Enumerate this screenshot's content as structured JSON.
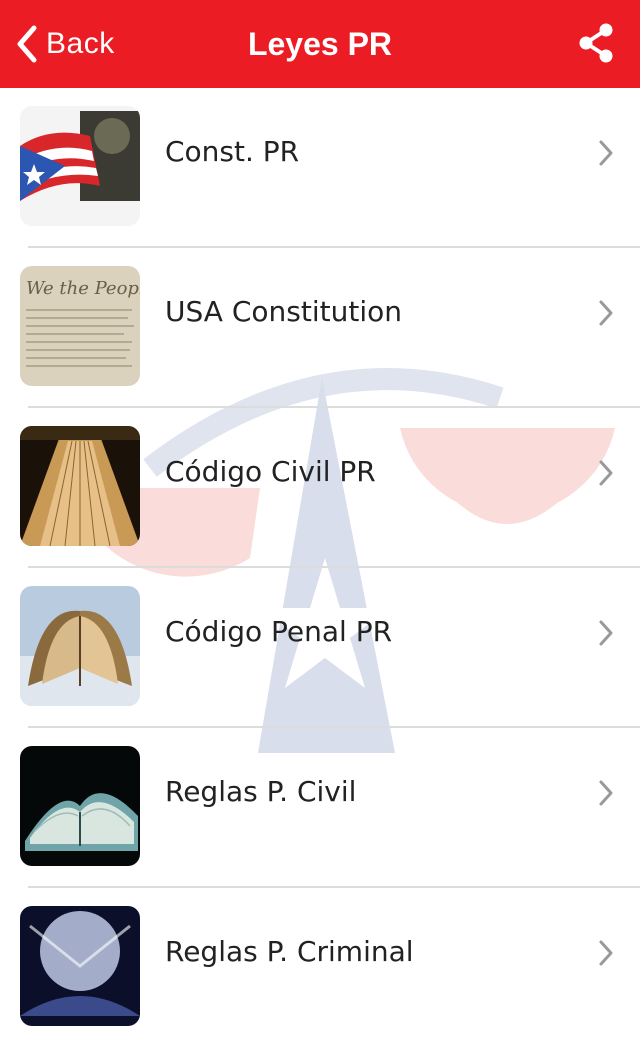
{
  "header": {
    "back_label": "Back",
    "title": "Leyes PR",
    "back_icon": "chevron-left-icon",
    "share_icon": "share-icon",
    "color": "#ec1c24"
  },
  "items": [
    {
      "label": "Const. PR",
      "icon": "puerto-rico-flag-thumbnail"
    },
    {
      "label": "USA Constitution",
      "icon": "parchment-thumbnail"
    },
    {
      "label": "Código Civil PR",
      "icon": "open-book-thumbnail"
    },
    {
      "label": "Código Penal PR",
      "icon": "fanned-book-thumbnail"
    },
    {
      "label": "Reglas P. Civil",
      "icon": "book-pages-thumbnail"
    },
    {
      "label": "Reglas P. Criminal",
      "icon": "book-light-thumbnail"
    }
  ]
}
